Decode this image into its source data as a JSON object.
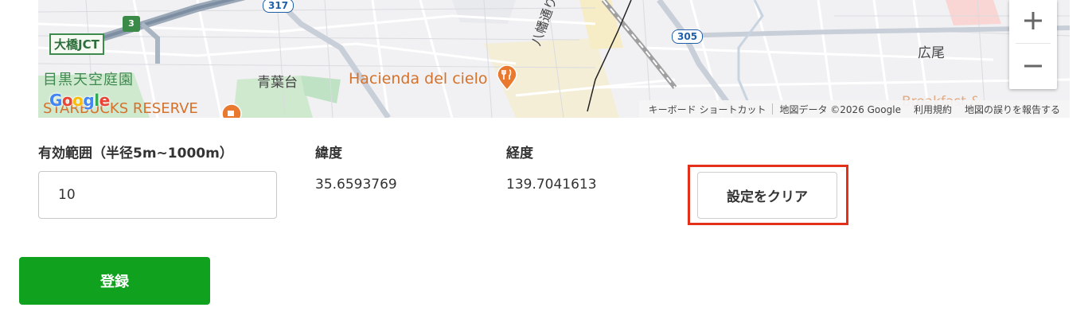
{
  "map": {
    "labels": {
      "jct": "大橋JCT",
      "garden": "目黒天空庭園",
      "aobadai": "青葉台",
      "hacienda": "Hacienda del cielo",
      "hachiman": "八幡通り",
      "hiroo": "広尾",
      "starbucks": "STARBUCKS RESERVE",
      "breakfast": "Breakfast &"
    },
    "route_shields": {
      "r3": "3",
      "r317": "317",
      "r305": "305"
    },
    "zoom": {
      "in": "+",
      "out": "−"
    },
    "google_logo": [
      "G",
      "o",
      "o",
      "g",
      "l",
      "e"
    ],
    "google_colors": [
      "#4285F4",
      "#EA4335",
      "#FBBC05",
      "#4285F4",
      "#34A853",
      "#EA4335"
    ],
    "attribution": {
      "shortcuts": "キーボード ショートカット",
      "map_data": "地図データ ©2026 Google",
      "terms": "利用規約",
      "report": "地図の誤りを報告する"
    }
  },
  "form": {
    "radius_label": "有効範囲（半径5m~1000m）",
    "radius_value": "10",
    "lat_label": "緯度",
    "lat_value": "35.6593769",
    "lng_label": "経度",
    "lng_value": "139.7041613",
    "clear_button": "設定をクリア",
    "submit_button": "登録"
  },
  "colors": {
    "submit": "#10a11e",
    "highlight": "#e2301b",
    "poi_orange": "#e8792e"
  }
}
